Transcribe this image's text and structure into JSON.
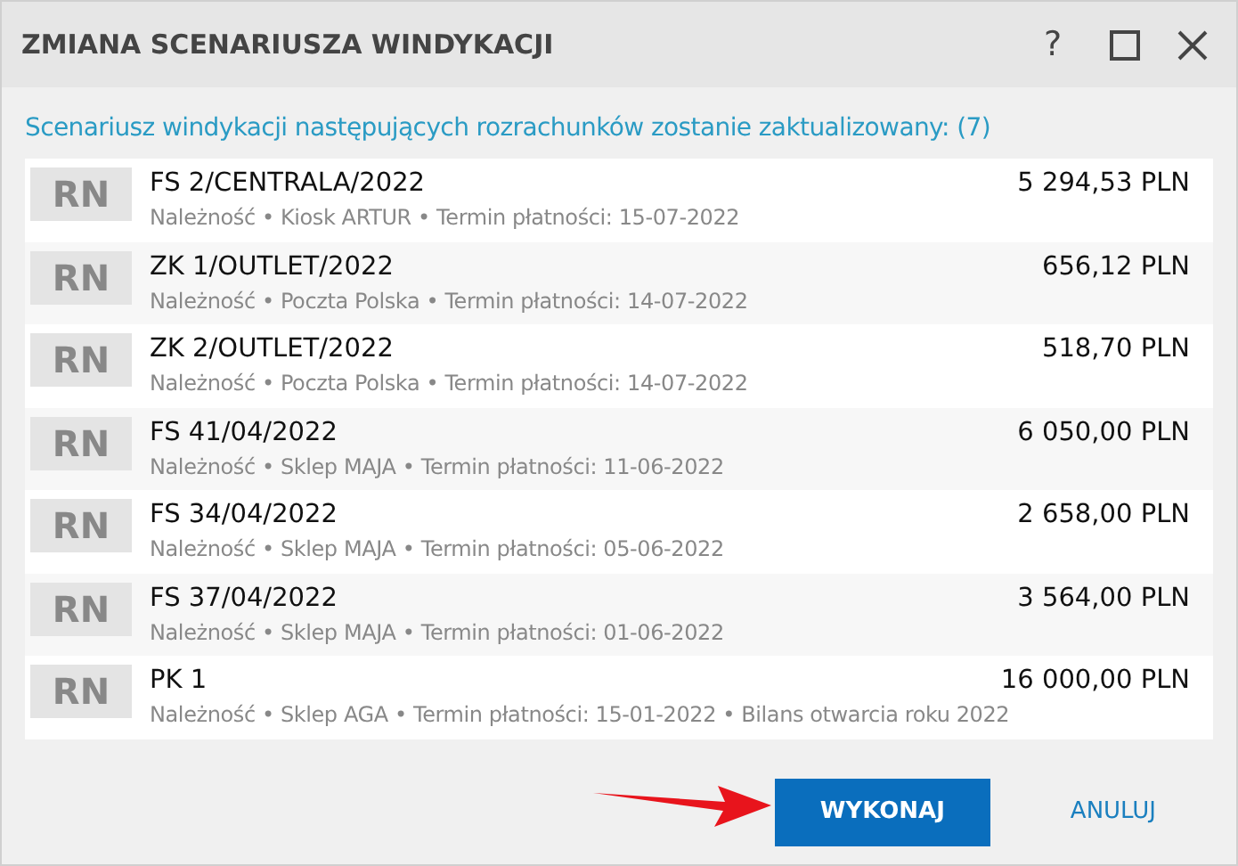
{
  "window": {
    "title": "ZMIANA SCENARIUSZA WINDYKACJI",
    "help_glyph": "?"
  },
  "summary": "Scenariusz windykacji następujących rozrachunków zostanie zaktualizowany: (7)",
  "rows": [
    {
      "badge": "RN",
      "number": "FS 2/CENTRALA/2022",
      "amount": "5 294,53 PLN",
      "details": "Należność • Kiosk ARTUR • Termin płatności: 15-07-2022"
    },
    {
      "badge": "RN",
      "number": "ZK 1/OUTLET/2022",
      "amount": "656,12 PLN",
      "details": "Należność • Poczta Polska • Termin płatności: 14-07-2022"
    },
    {
      "badge": "RN",
      "number": "ZK 2/OUTLET/2022",
      "amount": "518,70 PLN",
      "details": "Należność • Poczta Polska • Termin płatności: 14-07-2022"
    },
    {
      "badge": "RN",
      "number": "FS 41/04/2022",
      "amount": "6 050,00 PLN",
      "details": "Należność • Sklep MAJA • Termin płatności: 11-06-2022"
    },
    {
      "badge": "RN",
      "number": "FS 34/04/2022",
      "amount": "2 658,00 PLN",
      "details": "Należność • Sklep MAJA • Termin płatności: 05-06-2022"
    },
    {
      "badge": "RN",
      "number": "FS 37/04/2022",
      "amount": "3 564,00 PLN",
      "details": "Należność • Sklep MAJA • Termin płatności: 01-06-2022"
    },
    {
      "badge": "RN",
      "number": "PK 1",
      "amount": "16 000,00 PLN",
      "details": "Należność • Sklep AGA • Termin płatności: 15-01-2022 • Bilans otwarcia roku 2022"
    }
  ],
  "buttons": [
    {
      "label": "WYKONAJ",
      "kind": "primary"
    },
    {
      "label": "ANULUJ",
      "kind": "link"
    }
  ]
}
